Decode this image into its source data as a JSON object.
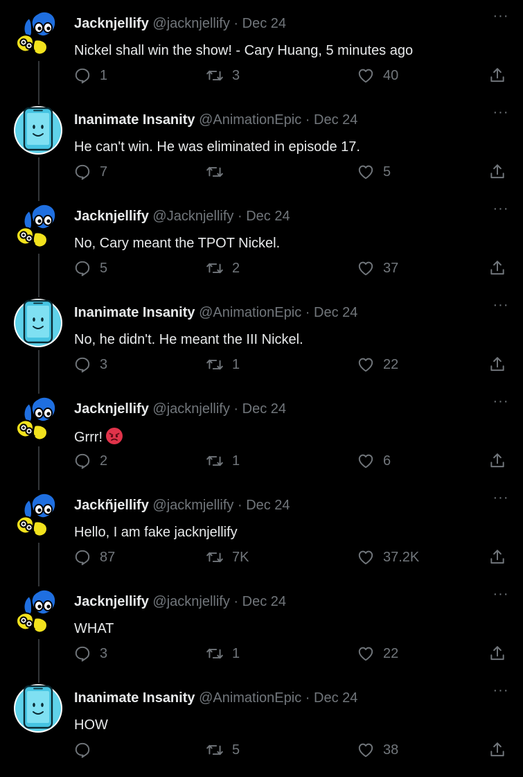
{
  "colors": {
    "background": "#000000",
    "text": "#e7e9ea",
    "muted": "#71767b",
    "thread_line": "#333639"
  },
  "tweets": [
    {
      "avatar": "bfdi-avatar",
      "name": "Jacknjellify",
      "handle": "@jacknjellify",
      "separator": "·",
      "date": "Dec 24",
      "text": "Nickel shall win the show! - Cary Huang, 5 minutes ago",
      "emoji": "",
      "replies": "1",
      "retweets": "3",
      "likes": "40",
      "more": "···"
    },
    {
      "avatar": "ii-phone-avatar",
      "name": "Inanimate Insanity",
      "handle": "@AnimationEpic",
      "separator": "·",
      "date": "Dec 24",
      "text": "He can't win. He was eliminated in episode 17.",
      "emoji": "",
      "replies": "7",
      "retweets": "",
      "likes": "5",
      "more": "···"
    },
    {
      "avatar": "bfdi-avatar",
      "name": "Jacknjellify",
      "handle": "@Jacknjellify",
      "separator": "·",
      "date": "Dec 24",
      "text": "No, Cary meant the TPOT Nickel.",
      "emoji": "",
      "replies": "5",
      "retweets": "2",
      "likes": "37",
      "more": "···"
    },
    {
      "avatar": "ii-phone-avatar",
      "name": "Inanimate Insanity",
      "handle": "@AnimationEpic",
      "separator": "·",
      "date": "Dec 24",
      "text": "No, he didn't. He meant the III Nickel.",
      "emoji": "",
      "replies": "3",
      "retweets": "1",
      "likes": "22",
      "more": "···"
    },
    {
      "avatar": "bfdi-avatar",
      "name": "Jacknjellify",
      "handle": "@jacknjellify",
      "separator": "·",
      "date": "Dec 24",
      "text": "Grrr!",
      "emoji": "angry-face-emoji",
      "replies": "2",
      "retweets": "1",
      "likes": "6",
      "more": "···"
    },
    {
      "avatar": "bfdi-avatar",
      "name": "Jackñjellify",
      "handle": "@jackmjellify",
      "separator": "·",
      "date": "Dec 24",
      "text": "Hello, I am fake jacknjellify",
      "emoji": "",
      "replies": "87",
      "retweets": "7K",
      "likes": "37.2K",
      "more": "···"
    },
    {
      "avatar": "bfdi-avatar",
      "name": "Jacknjellify",
      "handle": "@jacknjellify",
      "separator": "·",
      "date": "Dec 24",
      "text": "WHAT",
      "emoji": "",
      "replies": "3",
      "retweets": "1",
      "likes": "22",
      "more": "···"
    },
    {
      "avatar": "ii-phone-avatar",
      "name": "Inanimate Insanity",
      "handle": "@AnimationEpic",
      "separator": "·",
      "date": "Dec 24",
      "text": "HOW",
      "emoji": "",
      "replies": "",
      "retweets": "5",
      "likes": "38",
      "more": "···"
    }
  ]
}
